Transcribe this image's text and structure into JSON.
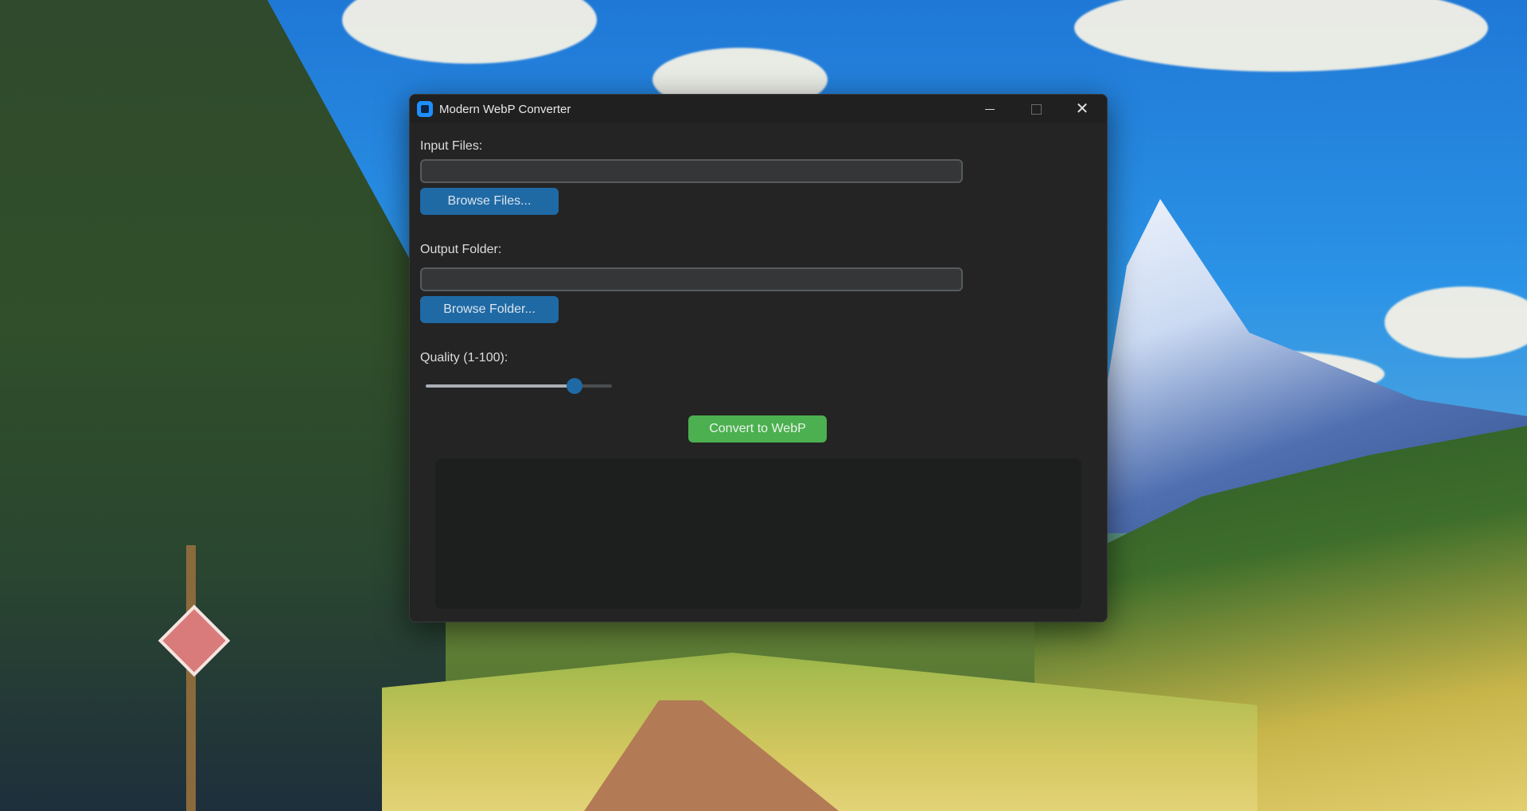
{
  "window": {
    "title": "Modern WebP Converter"
  },
  "input_files": {
    "label": "Input Files:",
    "value": "",
    "browse_label": "Browse Files..."
  },
  "output_folder": {
    "label": "Output Folder:",
    "value": "",
    "browse_label": "Browse Folder..."
  },
  "quality": {
    "label": "Quality (1-100):",
    "value": 80,
    "min": 1,
    "max": 100
  },
  "convert": {
    "label": "Convert to WebP"
  },
  "log": {
    "text": ""
  },
  "colors": {
    "accent": "#1f6aa5",
    "convert_green": "#4caf50",
    "window_bg": "#242424"
  },
  "icons": {
    "app": "app-icon",
    "minimize": "minimize-icon",
    "maximize": "maximize-icon",
    "close": "close-icon"
  }
}
